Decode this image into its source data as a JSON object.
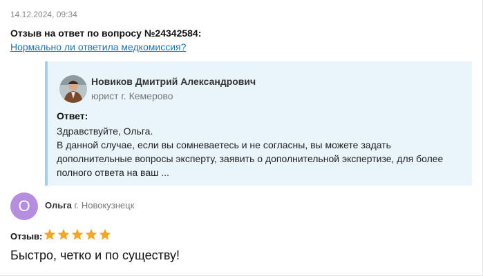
{
  "review": {
    "date": "14.12.2024, 09:34",
    "title": "Отзыв на ответ по вопросу №24342584:",
    "question_link": "Нормально ли ответила медкомиссия?"
  },
  "answer": {
    "lawyer_name": "Новиков Дмитрий Александрович",
    "lawyer_role": "юрист г. Кемерово",
    "label": "Ответ:",
    "text_lines": [
      "Здравствуйте, Ольга.",
      "В данной случае, если вы сомневаетесь и не согласны, вы можете задать",
      "дополнительные вопросы эксперту, заявить о дополнительной экспертизе, для более",
      "полного ответа на ваш ..."
    ]
  },
  "author": {
    "initial": "О",
    "name": "Ольга",
    "city": "г. Новокузнецк"
  },
  "rating": {
    "label": "Отзыв:",
    "stars": 5,
    "max": 5,
    "star_color": "#f5a623"
  },
  "feedback_text": "Быстро, четко и по существу!"
}
